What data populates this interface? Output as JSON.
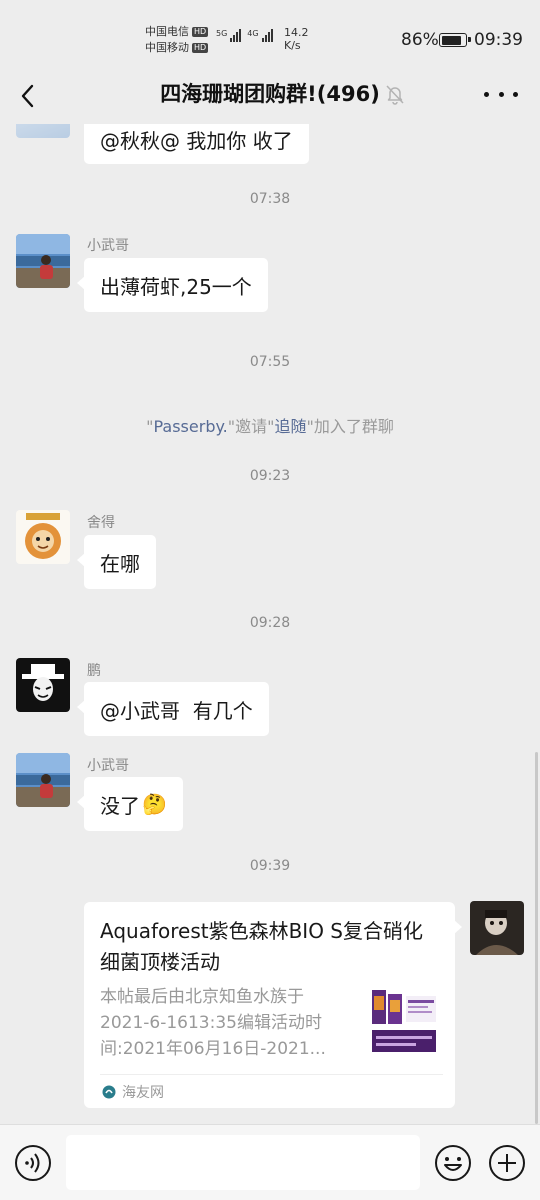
{
  "status_bar": {
    "carrier1": "中国电信",
    "carrier2": "中国移动",
    "hd": "HD",
    "net1": "5G",
    "net2": "4G",
    "speed_value": "14.2",
    "speed_unit": "K/s",
    "battery_percent": "86%",
    "battery_level": 0.86,
    "time": "09:39"
  },
  "header": {
    "title": "四海珊瑚团购群!(496)",
    "back_icon": "chevron-left-icon",
    "mute_icon": "bell-off-icon",
    "more_icon": "more-dots-icon"
  },
  "messages": {
    "m0_text": "@秋秋@ 我加你 收了",
    "ts1": "07:38",
    "m1_sender": "小武哥",
    "m1_text": "出薄荷虾,25一个",
    "ts2": "07:55",
    "sys_quote1": "\"",
    "sys_user1": "Passerby.",
    "sys_mid": "\"邀请\"",
    "sys_user2": "追随",
    "sys_tail": "\"加入了群聊",
    "ts3": "09:23",
    "m2_sender": "舍得",
    "m2_text": "在哪",
    "ts4": "09:28",
    "m3_sender": "鹏",
    "m3_text": "@小武哥  有几个",
    "m4_sender": "小武哥",
    "m4_text": "没了",
    "m4_emoji": "🤔",
    "ts5": "09:39"
  },
  "card": {
    "title": "Aquaforest紫色森林BIO S复合硝化细菌顶楼活动",
    "desc": "本帖最后由北京知鱼水族于2021-6-1613:35编辑活动时间:2021年06月16日-2021...",
    "source": "海友网"
  },
  "input_bar": {
    "placeholder": "",
    "voice_icon": "voice-icon",
    "emoji_icon": "emoji-icon",
    "plus_icon": "plus-icon"
  },
  "colors": {
    "background": "#ededed",
    "bubble": "#ffffff",
    "link": "#576b95",
    "timestamp": "#8a8a8a"
  }
}
